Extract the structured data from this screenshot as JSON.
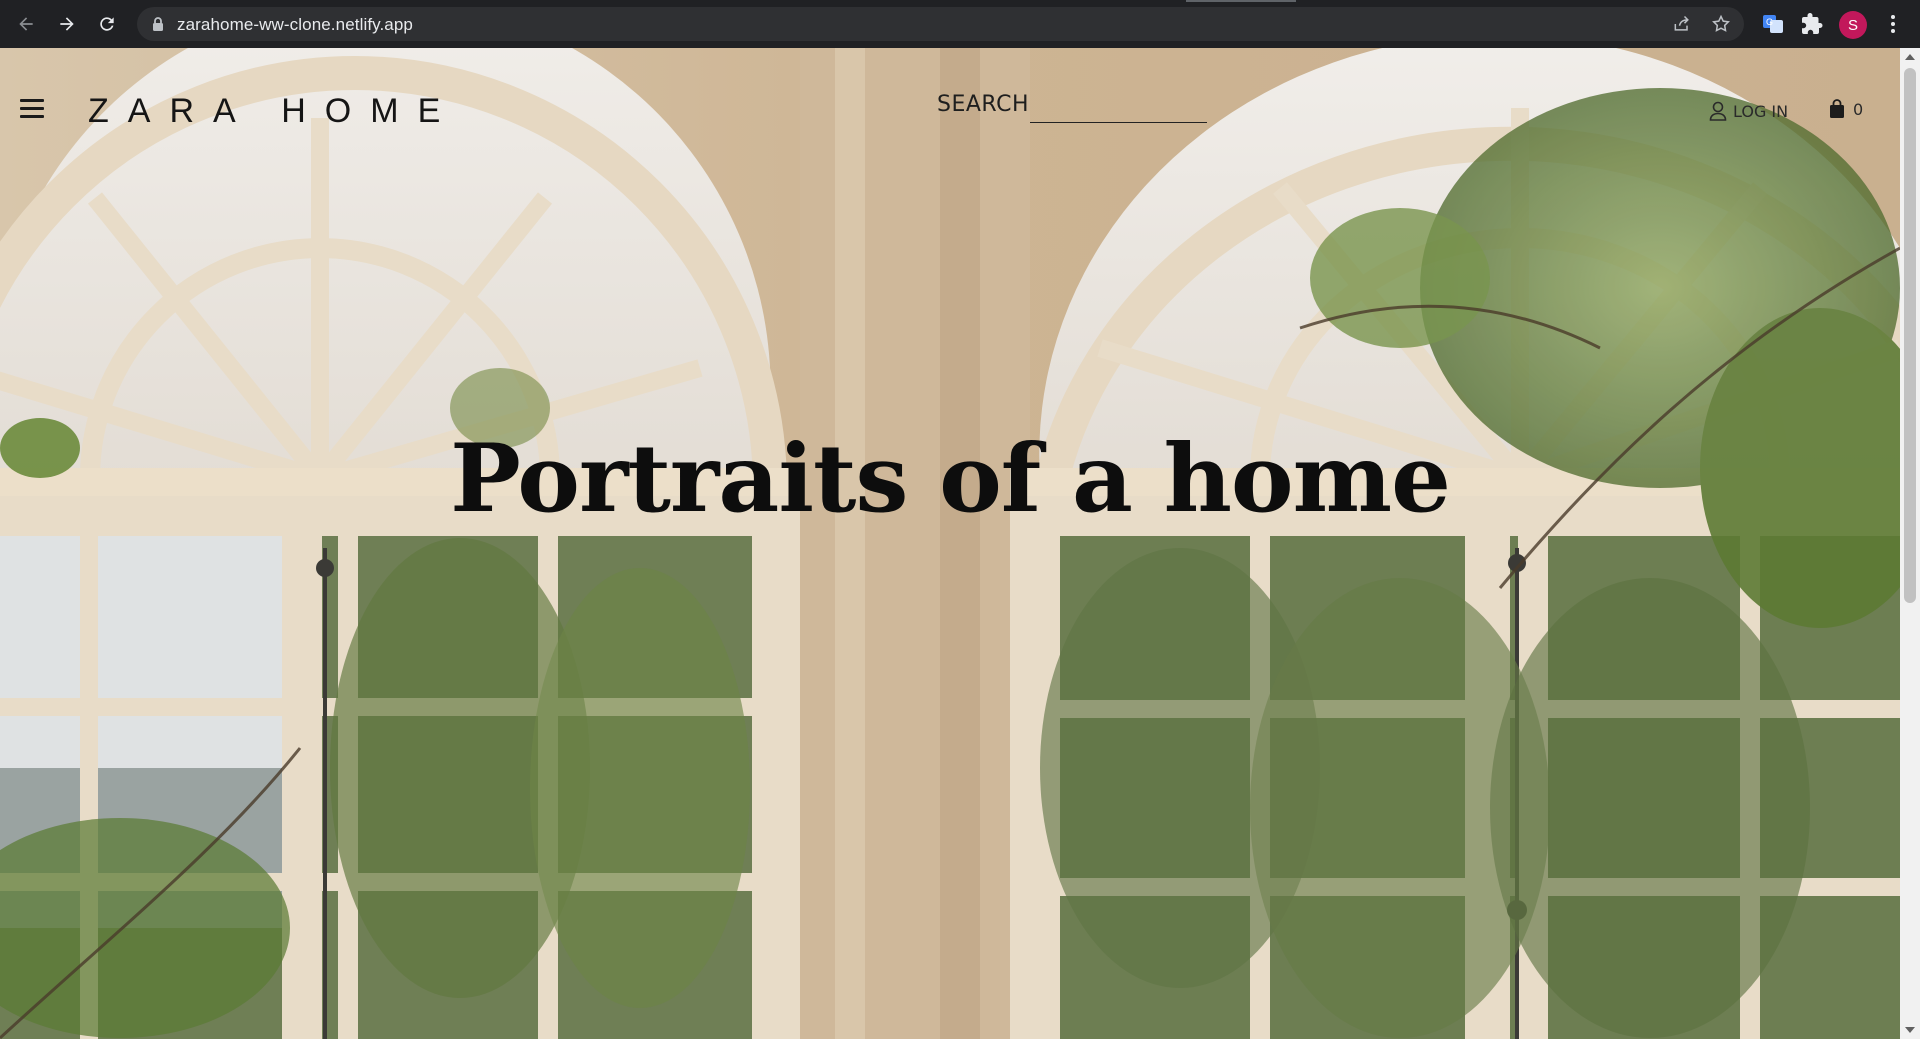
{
  "browser": {
    "url": "zarahome-ww-clone.netlify.app",
    "profile_initial": "S",
    "icons": [
      "back-icon",
      "forward-icon",
      "reload-icon",
      "lock-icon",
      "share-icon",
      "bookmark-star-icon",
      "translate-extension-icon",
      "extensions-puzzle-icon",
      "menu-dots-icon"
    ]
  },
  "header": {
    "logo": "ZARA HOME",
    "search_label": "SEARCH",
    "search_value": "",
    "login_label": "LOG IN",
    "cart_count": "0"
  },
  "hero": {
    "title": "Portraits of a home"
  },
  "colors": {
    "chrome_bg": "#202124",
    "omnibox_bg": "#2f3033",
    "text_dark": "#0d0d0d",
    "hero_tone": "#cdb89b",
    "profile": "#c2185b"
  }
}
